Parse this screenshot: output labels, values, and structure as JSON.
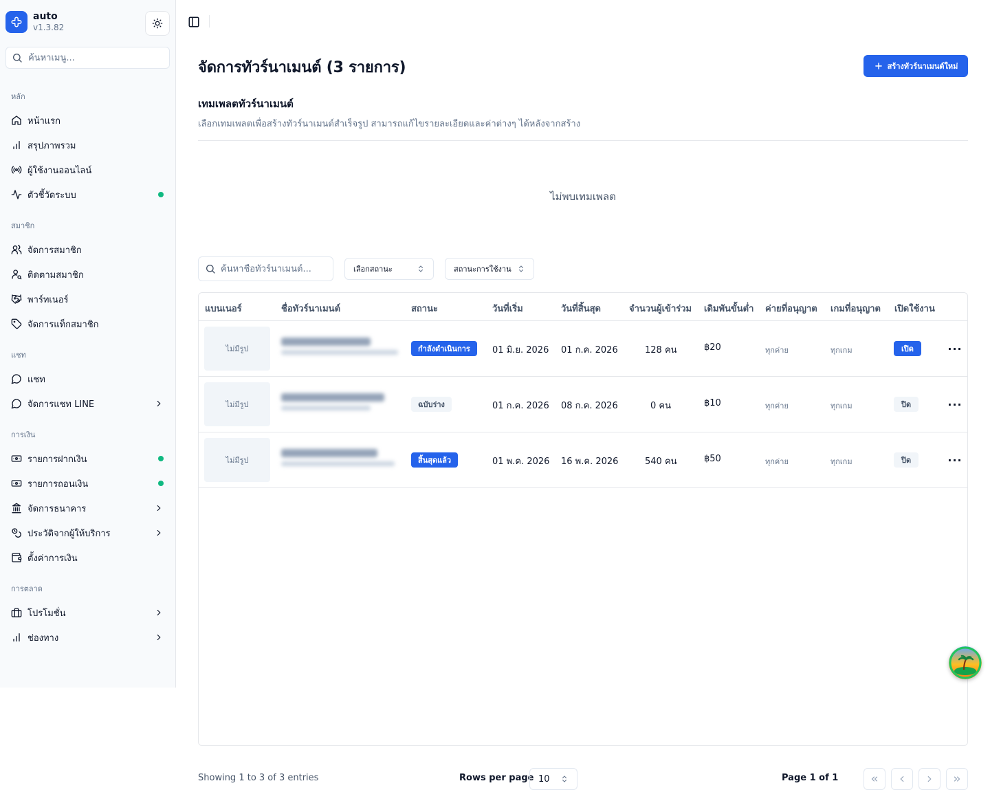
{
  "app": {
    "name": "auto",
    "version": "v1.3.82"
  },
  "sidebar": {
    "search_placeholder": "ค้นหาเมนู...",
    "groups": [
      {
        "label": "หลัก",
        "items": [
          {
            "label": "หน้าแรก",
            "icon": "home-icon"
          },
          {
            "label": "สรุปภาพรวม",
            "icon": "bar-chart-icon"
          },
          {
            "label": "ผู้ใช้งานออนไลน์",
            "icon": "radio-icon"
          },
          {
            "label": "ตัวชี้วัดระบบ",
            "icon": "activity-icon",
            "dot": true
          }
        ]
      },
      {
        "label": "สมาชิก",
        "items": [
          {
            "label": "จัดการสมาชิก",
            "icon": "users-icon"
          },
          {
            "label": "ติดตามสมาชิก",
            "icon": "user-search-icon"
          },
          {
            "label": "พาร์ทเนอร์",
            "icon": "handshake-icon"
          },
          {
            "label": "จัดการแท็กสมาชิก",
            "icon": "tag-icon"
          }
        ]
      },
      {
        "label": "แชท",
        "items": [
          {
            "label": "แชท",
            "icon": "chat-icon"
          },
          {
            "label": "จัดการแชท LINE",
            "icon": "chat-icon",
            "chevron": true
          }
        ]
      },
      {
        "label": "การเงิน",
        "items": [
          {
            "label": "รายการฝากเงิน",
            "icon": "deposit-icon",
            "dot": true
          },
          {
            "label": "รายการถอนเงิน",
            "icon": "withdraw-icon",
            "dot": true
          },
          {
            "label": "จัดการธนาคาร",
            "icon": "bank-icon",
            "chevron": true
          },
          {
            "label": "ประวัติจากผู้ให้บริการ",
            "icon": "history-icon",
            "chevron": true
          },
          {
            "label": "ตั้งค่าการเงิน",
            "icon": "wallet-icon"
          }
        ]
      },
      {
        "label": "การตลาด",
        "items": [
          {
            "label": "โปรโมชั่น",
            "icon": "briefcase-icon",
            "chevron": true
          },
          {
            "label": "ช่องทาง",
            "icon": "bar-chart-icon",
            "chevron": true
          }
        ]
      }
    ]
  },
  "main": {
    "title": "จัดการทัวร์นาเมนต์ (3 รายการ)",
    "create_button": "สร้างทัวร์นาเมนต์ใหม่",
    "templates": {
      "title": "เทมเพลตทัวร์นาเมนต์",
      "description": "เลือกเทมเพลตเพื่อสร้างทัวร์นาเมนต์สำเร็จรูป สามารถแก้ไขรายละเอียดและค่าต่างๆ ได้หลังจากสร้าง",
      "empty": "ไม่พบเทมเพลต"
    },
    "filters": {
      "search_placeholder": "ค้นหาชื่อทัวร์นาเมนต์...",
      "status_select": "เลือกสถานะ",
      "usage_select": "สถานะการใช้งาน"
    },
    "table": {
      "columns": [
        "แบนเนอร์",
        "ชื่อทัวร์นาเมนต์",
        "สถานะ",
        "วันที่เริ่ม",
        "วันที่สิ้นสุด",
        "จำนวนผู้เข้าร่วม",
        "เดิมพันขั้นต่ำ",
        "ค่ายที่อนุญาต",
        "เกมที่อนุญาต",
        "เปิดใช้งาน"
      ],
      "rows": [
        {
          "banner": "ไม่มีรูป",
          "status": "กำลังดำเนินการ",
          "status_style": "blue",
          "start": "01 มิ.ย. 2026",
          "end": "01 ก.ค. 2026",
          "participants": "128 คน",
          "min_bet": "฿20",
          "providers": "ทุกค่าย",
          "games": "ทุกเกม",
          "enabled": "เปิด",
          "enabled_style": "blue"
        },
        {
          "banner": "ไม่มีรูป",
          "status": "ฉบับร่าง",
          "status_style": "gray",
          "start": "01 ก.ค. 2026",
          "end": "08 ก.ค. 2026",
          "participants": "0 คน",
          "min_bet": "฿10",
          "providers": "ทุกค่าย",
          "games": "ทุกเกม",
          "enabled": "ปิด",
          "enabled_style": "gray"
        },
        {
          "banner": "ไม่มีรูป",
          "status": "สิ้นสุดแล้ว",
          "status_style": "blue",
          "start": "01 พ.ค. 2026",
          "end": "16 พ.ค. 2026",
          "participants": "540 คน",
          "min_bet": "฿50",
          "providers": "ทุกค่าย",
          "games": "ทุกเกม",
          "enabled": "ปิด",
          "enabled_style": "gray"
        }
      ]
    },
    "footer": {
      "showing": "Showing 1 to 3 of 3 entries",
      "rows_per_page_label": "Rows per page",
      "rows_per_page": "10",
      "page_info": "Page 1 of 1"
    }
  },
  "colors": {
    "accent": "#2563eb",
    "online_dot": "#10b981"
  }
}
